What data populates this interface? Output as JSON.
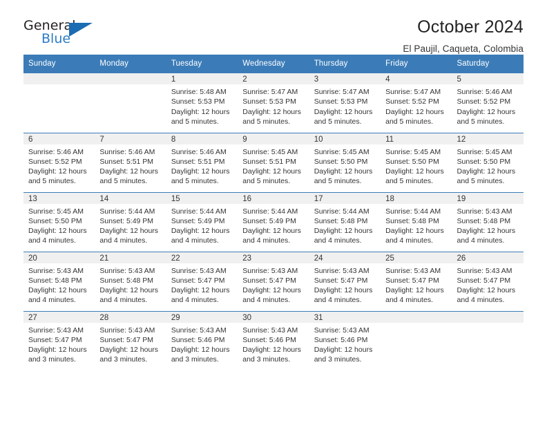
{
  "brand": {
    "name_top": "General",
    "name_bottom": "Blue",
    "triangle_color": "#1b6cb3",
    "text_color": "#231f20",
    "blue_color": "#2b7cc4"
  },
  "header": {
    "title": "October 2024",
    "subtitle": "El Paujil, Caqueta, Colombia"
  },
  "theme": {
    "header_bg": "#3b7cb8",
    "daynum_bg": "#f0f0f0",
    "text": "#333333"
  },
  "calendar": {
    "weekday_headers": [
      "Sunday",
      "Monday",
      "Tuesday",
      "Wednesday",
      "Thursday",
      "Friday",
      "Saturday"
    ],
    "labels": {
      "sunrise_prefix": "Sunrise: ",
      "sunset_prefix": "Sunset: ",
      "daylight_prefix": "Daylight: "
    },
    "weeks": [
      [
        {
          "day": "",
          "sunrise": "",
          "sunset": "",
          "daylight": ""
        },
        {
          "day": "",
          "sunrise": "",
          "sunset": "",
          "daylight": ""
        },
        {
          "day": "1",
          "sunrise": "Sunrise: 5:48 AM",
          "sunset": "Sunset: 5:53 PM",
          "daylight": "Daylight: 12 hours and 5 minutes."
        },
        {
          "day": "2",
          "sunrise": "Sunrise: 5:47 AM",
          "sunset": "Sunset: 5:53 PM",
          "daylight": "Daylight: 12 hours and 5 minutes."
        },
        {
          "day": "3",
          "sunrise": "Sunrise: 5:47 AM",
          "sunset": "Sunset: 5:53 PM",
          "daylight": "Daylight: 12 hours and 5 minutes."
        },
        {
          "day": "4",
          "sunrise": "Sunrise: 5:47 AM",
          "sunset": "Sunset: 5:52 PM",
          "daylight": "Daylight: 12 hours and 5 minutes."
        },
        {
          "day": "5",
          "sunrise": "Sunrise: 5:46 AM",
          "sunset": "Sunset: 5:52 PM",
          "daylight": "Daylight: 12 hours and 5 minutes."
        }
      ],
      [
        {
          "day": "6",
          "sunrise": "Sunrise: 5:46 AM",
          "sunset": "Sunset: 5:52 PM",
          "daylight": "Daylight: 12 hours and 5 minutes."
        },
        {
          "day": "7",
          "sunrise": "Sunrise: 5:46 AM",
          "sunset": "Sunset: 5:51 PM",
          "daylight": "Daylight: 12 hours and 5 minutes."
        },
        {
          "day": "8",
          "sunrise": "Sunrise: 5:46 AM",
          "sunset": "Sunset: 5:51 PM",
          "daylight": "Daylight: 12 hours and 5 minutes."
        },
        {
          "day": "9",
          "sunrise": "Sunrise: 5:45 AM",
          "sunset": "Sunset: 5:51 PM",
          "daylight": "Daylight: 12 hours and 5 minutes."
        },
        {
          "day": "10",
          "sunrise": "Sunrise: 5:45 AM",
          "sunset": "Sunset: 5:50 PM",
          "daylight": "Daylight: 12 hours and 5 minutes."
        },
        {
          "day": "11",
          "sunrise": "Sunrise: 5:45 AM",
          "sunset": "Sunset: 5:50 PM",
          "daylight": "Daylight: 12 hours and 5 minutes."
        },
        {
          "day": "12",
          "sunrise": "Sunrise: 5:45 AM",
          "sunset": "Sunset: 5:50 PM",
          "daylight": "Daylight: 12 hours and 5 minutes."
        }
      ],
      [
        {
          "day": "13",
          "sunrise": "Sunrise: 5:45 AM",
          "sunset": "Sunset: 5:50 PM",
          "daylight": "Daylight: 12 hours and 4 minutes."
        },
        {
          "day": "14",
          "sunrise": "Sunrise: 5:44 AM",
          "sunset": "Sunset: 5:49 PM",
          "daylight": "Daylight: 12 hours and 4 minutes."
        },
        {
          "day": "15",
          "sunrise": "Sunrise: 5:44 AM",
          "sunset": "Sunset: 5:49 PM",
          "daylight": "Daylight: 12 hours and 4 minutes."
        },
        {
          "day": "16",
          "sunrise": "Sunrise: 5:44 AM",
          "sunset": "Sunset: 5:49 PM",
          "daylight": "Daylight: 12 hours and 4 minutes."
        },
        {
          "day": "17",
          "sunrise": "Sunrise: 5:44 AM",
          "sunset": "Sunset: 5:48 PM",
          "daylight": "Daylight: 12 hours and 4 minutes."
        },
        {
          "day": "18",
          "sunrise": "Sunrise: 5:44 AM",
          "sunset": "Sunset: 5:48 PM",
          "daylight": "Daylight: 12 hours and 4 minutes."
        },
        {
          "day": "19",
          "sunrise": "Sunrise: 5:43 AM",
          "sunset": "Sunset: 5:48 PM",
          "daylight": "Daylight: 12 hours and 4 minutes."
        }
      ],
      [
        {
          "day": "20",
          "sunrise": "Sunrise: 5:43 AM",
          "sunset": "Sunset: 5:48 PM",
          "daylight": "Daylight: 12 hours and 4 minutes."
        },
        {
          "day": "21",
          "sunrise": "Sunrise: 5:43 AM",
          "sunset": "Sunset: 5:48 PM",
          "daylight": "Daylight: 12 hours and 4 minutes."
        },
        {
          "day": "22",
          "sunrise": "Sunrise: 5:43 AM",
          "sunset": "Sunset: 5:47 PM",
          "daylight": "Daylight: 12 hours and 4 minutes."
        },
        {
          "day": "23",
          "sunrise": "Sunrise: 5:43 AM",
          "sunset": "Sunset: 5:47 PM",
          "daylight": "Daylight: 12 hours and 4 minutes."
        },
        {
          "day": "24",
          "sunrise": "Sunrise: 5:43 AM",
          "sunset": "Sunset: 5:47 PM",
          "daylight": "Daylight: 12 hours and 4 minutes."
        },
        {
          "day": "25",
          "sunrise": "Sunrise: 5:43 AM",
          "sunset": "Sunset: 5:47 PM",
          "daylight": "Daylight: 12 hours and 4 minutes."
        },
        {
          "day": "26",
          "sunrise": "Sunrise: 5:43 AM",
          "sunset": "Sunset: 5:47 PM",
          "daylight": "Daylight: 12 hours and 4 minutes."
        }
      ],
      [
        {
          "day": "27",
          "sunrise": "Sunrise: 5:43 AM",
          "sunset": "Sunset: 5:47 PM",
          "daylight": "Daylight: 12 hours and 3 minutes."
        },
        {
          "day": "28",
          "sunrise": "Sunrise: 5:43 AM",
          "sunset": "Sunset: 5:47 PM",
          "daylight": "Daylight: 12 hours and 3 minutes."
        },
        {
          "day": "29",
          "sunrise": "Sunrise: 5:43 AM",
          "sunset": "Sunset: 5:46 PM",
          "daylight": "Daylight: 12 hours and 3 minutes."
        },
        {
          "day": "30",
          "sunrise": "Sunrise: 5:43 AM",
          "sunset": "Sunset: 5:46 PM",
          "daylight": "Daylight: 12 hours and 3 minutes."
        },
        {
          "day": "31",
          "sunrise": "Sunrise: 5:43 AM",
          "sunset": "Sunset: 5:46 PM",
          "daylight": "Daylight: 12 hours and 3 minutes."
        },
        {
          "day": "",
          "sunrise": "",
          "sunset": "",
          "daylight": ""
        },
        {
          "day": "",
          "sunrise": "",
          "sunset": "",
          "daylight": ""
        }
      ]
    ]
  }
}
